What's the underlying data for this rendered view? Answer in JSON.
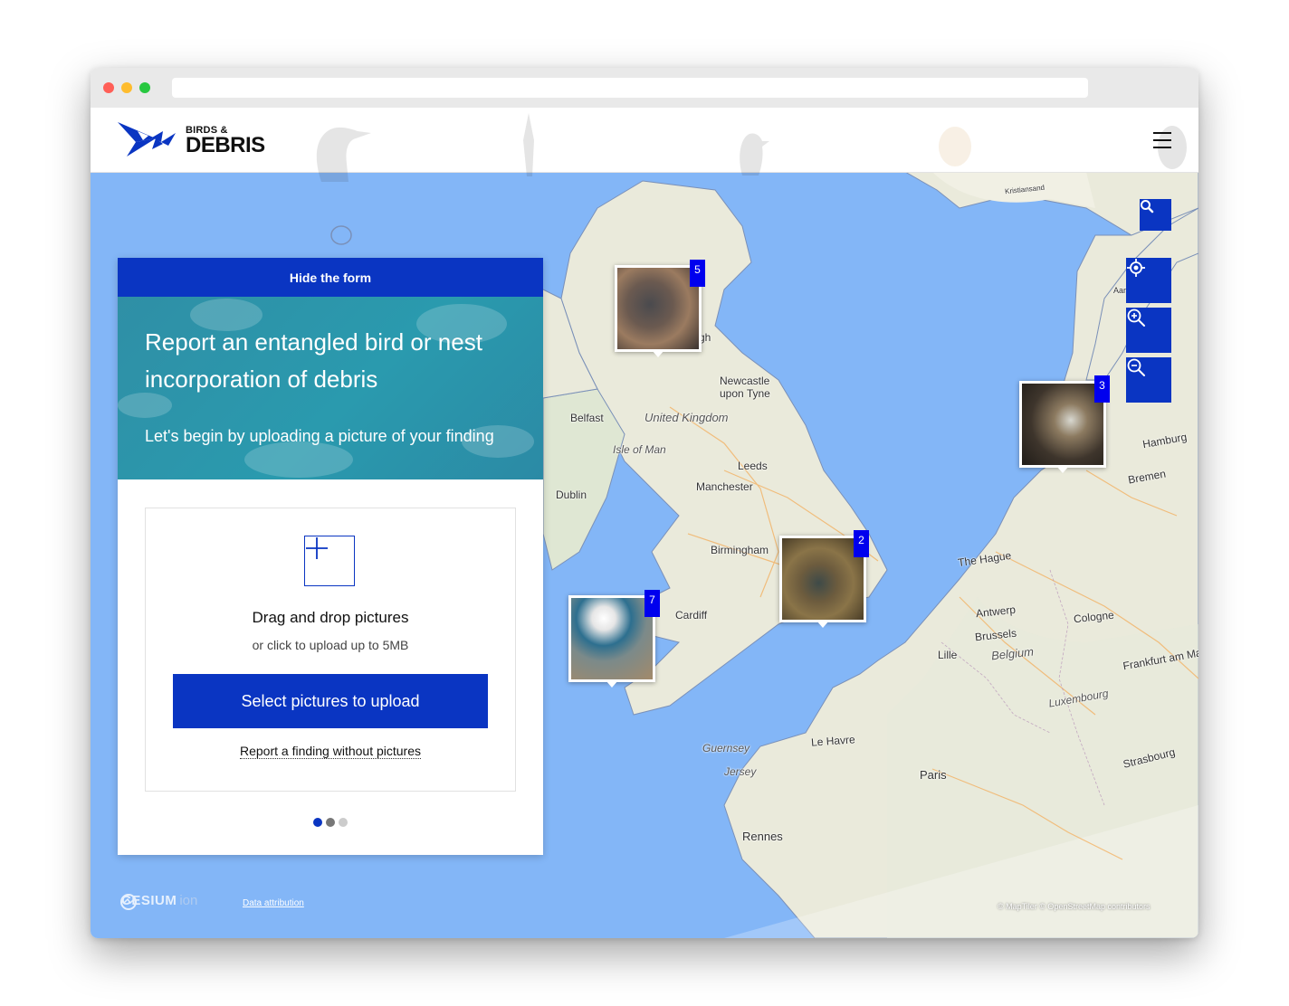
{
  "browser": {
    "dot_colors": [
      "#ff5f57",
      "#febc2e",
      "#28c840"
    ]
  },
  "header": {
    "brand_line1": "BIRDS &",
    "brand_line2": "DEBRIS"
  },
  "panel": {
    "hide_label": "Hide the form",
    "title": "Report an entangled bird or nest incorporation of debris",
    "subtitle": "Let's begin by uploading a picture of your finding",
    "drop_title": "Drag and drop pictures",
    "drop_sub": "or click to upload up to 5MB",
    "upload_button": "Select pictures to upload",
    "no_picture_link": "Report a finding without pictures",
    "step_colors": [
      "#0a35c2",
      "#777777",
      "#cccccc"
    ]
  },
  "map": {
    "labels": [
      {
        "text": "Newcastle"
      },
      {
        "text": "upon Tyne"
      },
      {
        "text": "Belfast"
      },
      {
        "text": "United Kingdom"
      },
      {
        "text": "Isle of Man"
      },
      {
        "text": "Leeds"
      },
      {
        "text": "Dublin"
      },
      {
        "text": "Manchester"
      },
      {
        "text": "Birmingham"
      },
      {
        "text": "Cardiff"
      },
      {
        "text": "The Hague"
      },
      {
        "text": "Antwerp"
      },
      {
        "text": "Brussels"
      },
      {
        "text": "Belgium"
      },
      {
        "text": "Lille"
      },
      {
        "text": "Cologne"
      },
      {
        "text": "Luxembourg"
      },
      {
        "text": "Frankfurt am Main"
      },
      {
        "text": "Hamburg"
      },
      {
        "text": "Bremen"
      },
      {
        "text": "Le Havre"
      },
      {
        "text": "Guernsey"
      },
      {
        "text": "Jersey"
      },
      {
        "text": "Paris"
      },
      {
        "text": "Rennes"
      },
      {
        "text": "Strasbourg"
      },
      {
        "text": "Kristiansand"
      },
      {
        "text": "Aar"
      },
      {
        "text": "gh"
      }
    ],
    "markers": [
      {
        "count": "5"
      },
      {
        "count": "3"
      },
      {
        "count": "2"
      },
      {
        "count": "7"
      }
    ],
    "cesium_label": "CESIUM",
    "cesium_ion": "ion",
    "data_attribution": "Data attribution",
    "copyright": "© MapTiler © OpenStreetMap contributors",
    "accent_color": "#0a35c2",
    "sea_color": "#83b6f7"
  }
}
